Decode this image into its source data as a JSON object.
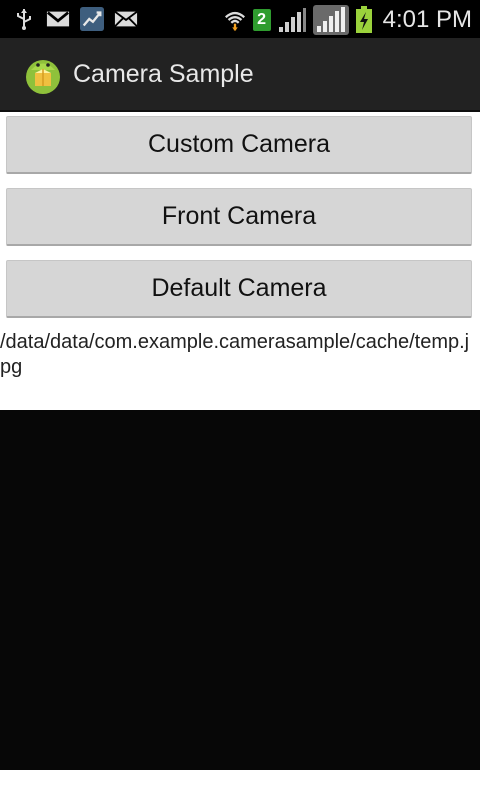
{
  "status_bar": {
    "time": "4:01 PM",
    "notification_badge": "2",
    "icons_left": [
      "usb-icon",
      "gmail-icon",
      "stocks-icon",
      "email-icon"
    ],
    "icons_right": [
      "wifi-icon",
      "badge-2-icon",
      "signal-icon",
      "signal-roaming-icon",
      "battery-charging-icon"
    ]
  },
  "action_bar": {
    "title": "Camera Sample",
    "icon": "android-icon"
  },
  "buttons": {
    "custom_camera": "Custom Camera",
    "front_camera": "Front Camera",
    "default_camera": "Default Camera"
  },
  "file_path": "/data/data/com.example.camerasample/cache/temp.jpg",
  "colors": {
    "status_bar_bg": "#000000",
    "action_bar_bg": "#222222",
    "button_bg": "#d6d6d6",
    "preview_bg": "#070707"
  }
}
